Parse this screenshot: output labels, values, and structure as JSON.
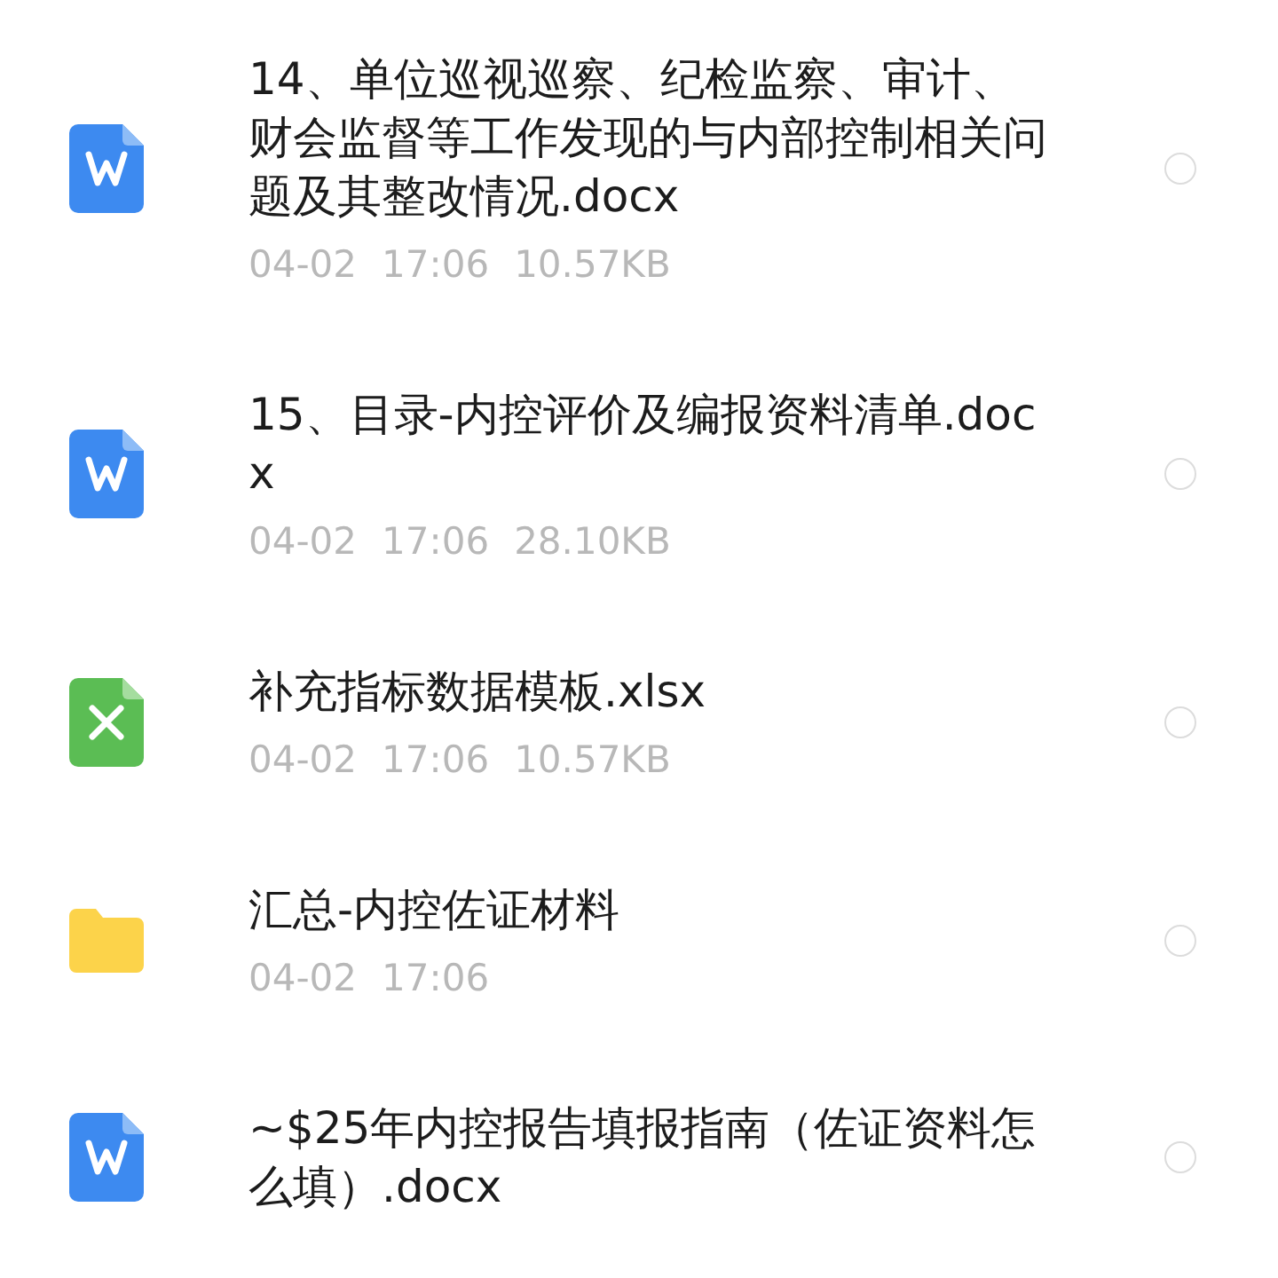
{
  "files": [
    {
      "kind": "word",
      "name": "14、单位巡视巡察、纪检监察、审计、财会监督等工作发现的与内部控制相关问题及其整改情况.docx",
      "date": "04-02",
      "time": "17:06",
      "size": "10.57KB",
      "selected": false
    },
    {
      "kind": "word",
      "name": "15、目录-内控评价及编报资料清单.docx",
      "date": "04-02",
      "time": "17:06",
      "size": "28.10KB",
      "selected": false
    },
    {
      "kind": "excel",
      "name": "补充指标数据模板.xlsx",
      "date": "04-02",
      "time": "17:06",
      "size": "10.57KB",
      "selected": false
    },
    {
      "kind": "folder",
      "name": "汇总-内控佐证材料",
      "date": "04-02",
      "time": "17:06",
      "selected": false
    },
    {
      "kind": "word",
      "name": "~$25年内控报告填报指南（佐证资料怎么填）.docx",
      "selected": false
    }
  ]
}
